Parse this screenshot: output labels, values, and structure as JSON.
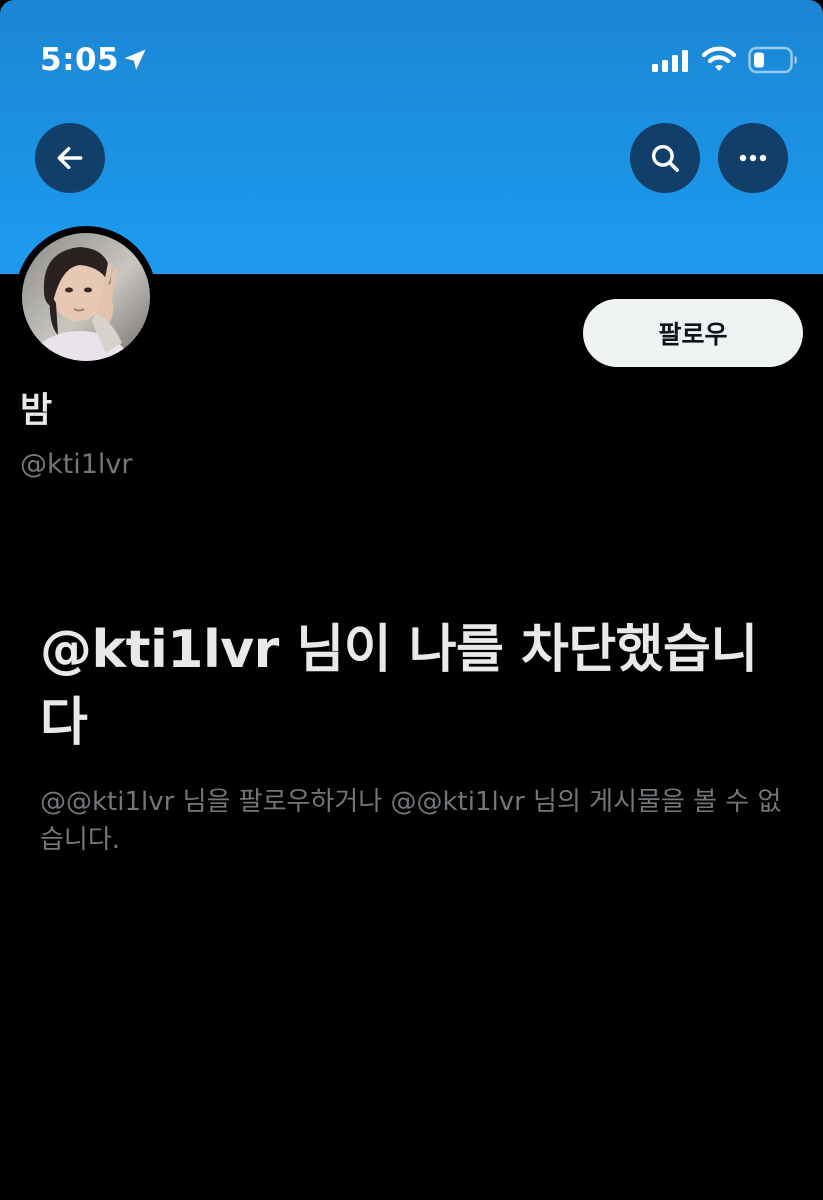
{
  "status_bar": {
    "time": "5:05"
  },
  "icons": {
    "location": "location-arrow-icon",
    "signal": "cellular-signal-icon",
    "wifi": "wifi-icon",
    "battery": "battery-low-icon",
    "back": "arrow-left-icon",
    "search": "search-icon",
    "more": "more-horizontal-icon"
  },
  "colors": {
    "banner": "#1d9bf0",
    "background": "#000000",
    "follow_button_bg": "#eff3f4",
    "secondary_text": "#71767b"
  },
  "profile": {
    "display_name": "밤",
    "handle": "@kti1lvr",
    "follow_label": "팔로우"
  },
  "blocked": {
    "title": "@kti1lvr 님이 나를 차단했습니다",
    "description": "@@kti1lvr 님을 팔로우하거나 @@kti1lvr 님의 게시물을 볼 수 없습니다."
  }
}
